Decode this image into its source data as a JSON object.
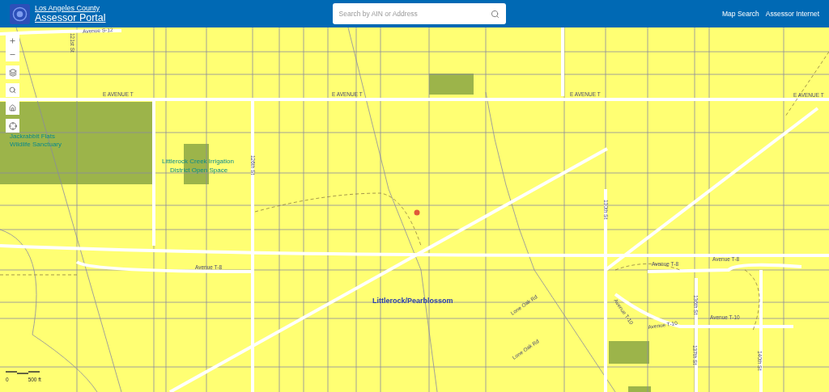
{
  "header": {
    "county_link": "Los Angeles County",
    "portal_link": "Assessor Portal",
    "search": {
      "placeholder": "Search by AIN or Address"
    },
    "nav_links": [
      "Map Search",
      "Assessor Internet"
    ]
  },
  "map": {
    "labels": [
      {
        "kind": "street",
        "text": "Avenue S-12"
      },
      {
        "kind": "street",
        "text": "121st St"
      },
      {
        "kind": "street",
        "text": "E AVENUE T"
      },
      {
        "kind": "street",
        "text": "E AVENUE T"
      },
      {
        "kind": "street",
        "text": "E AVENUE T"
      },
      {
        "kind": "street",
        "text": "E AVENUE T"
      },
      {
        "kind": "park",
        "text": "Jackrabbit Flats"
      },
      {
        "kind": "park",
        "text": "Wildlife Sanctuary"
      },
      {
        "kind": "park",
        "text": "Littlerock Creek Irrigation"
      },
      {
        "kind": "park",
        "text": "District Open Space"
      },
      {
        "kind": "street",
        "text": "126th St"
      },
      {
        "kind": "street",
        "text": "130th St"
      },
      {
        "kind": "street",
        "text": "Avenue T-8"
      },
      {
        "kind": "street",
        "text": "Avenue T-8"
      },
      {
        "kind": "street",
        "text": "Avenue T-8"
      },
      {
        "kind": "place",
        "text": "Littlerock/Pearblossom"
      },
      {
        "kind": "street",
        "text": "Lone Oak Rd"
      },
      {
        "kind": "street",
        "text": "Lone Oak Rd"
      },
      {
        "kind": "street",
        "text": "Avenue T-10"
      },
      {
        "kind": "street",
        "text": "Avenue T-10"
      },
      {
        "kind": "street",
        "text": "Avenue T-10"
      },
      {
        "kind": "street",
        "text": "136th St"
      },
      {
        "kind": "street",
        "text": "137th St"
      },
      {
        "kind": "street",
        "text": "140th St"
      }
    ],
    "scale": {
      "zero": "0",
      "distance": "500 ft"
    }
  }
}
